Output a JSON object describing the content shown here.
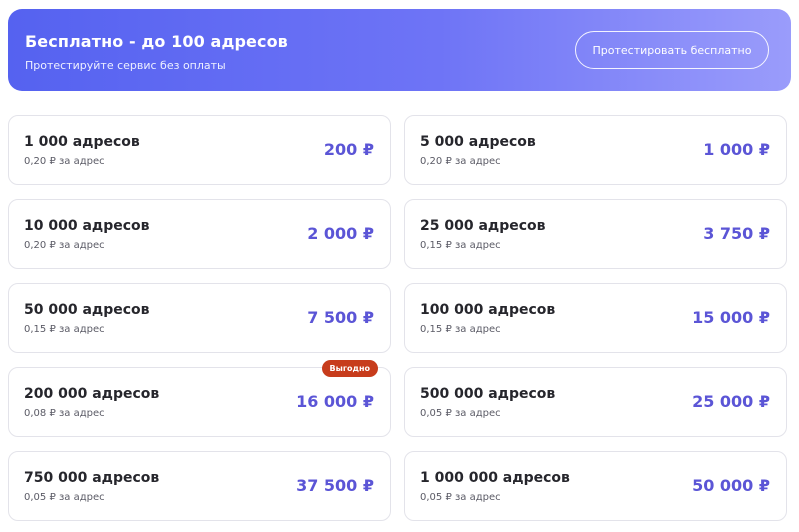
{
  "banner": {
    "title": "Бесплатно - до 100 адресов",
    "subtitle": "Протестируйте сервис без оплаты",
    "button_label": "Протестировать бесплатно"
  },
  "colors": {
    "accent": "#5b55d6",
    "banner_start": "#5562f0",
    "banner_end": "#9a9cfb",
    "badge": "#c73c1c"
  },
  "plans": [
    {
      "amount": "1 000 адресов",
      "rate": "0,20 ₽ за адрес",
      "price": "200 ₽"
    },
    {
      "amount": "5 000 адресов",
      "rate": "0,20 ₽ за адрес",
      "price": "1 000 ₽"
    },
    {
      "amount": "10 000 адресов",
      "rate": "0,20 ₽ за адрес",
      "price": "2 000 ₽"
    },
    {
      "amount": "25 000 адресов",
      "rate": "0,15 ₽ за адрес",
      "price": "3 750 ₽"
    },
    {
      "amount": "50 000 адресов",
      "rate": "0,15 ₽ за адрес",
      "price": "7 500 ₽"
    },
    {
      "amount": "100 000 адресов",
      "rate": "0,15 ₽ за адрес",
      "price": "15 000 ₽"
    },
    {
      "amount": "200 000 адресов",
      "rate": "0,08 ₽ за адрес",
      "price": "16 000 ₽",
      "badge": "Выгодно"
    },
    {
      "amount": "500 000 адресов",
      "rate": "0,05 ₽ за адрес",
      "price": "25 000 ₽"
    },
    {
      "amount": "750 000 адресов",
      "rate": "0,05 ₽ за адрес",
      "price": "37 500 ₽"
    },
    {
      "amount": "1 000 000 адресов",
      "rate": "0,05 ₽ за адрес",
      "price": "50 000 ₽"
    }
  ]
}
